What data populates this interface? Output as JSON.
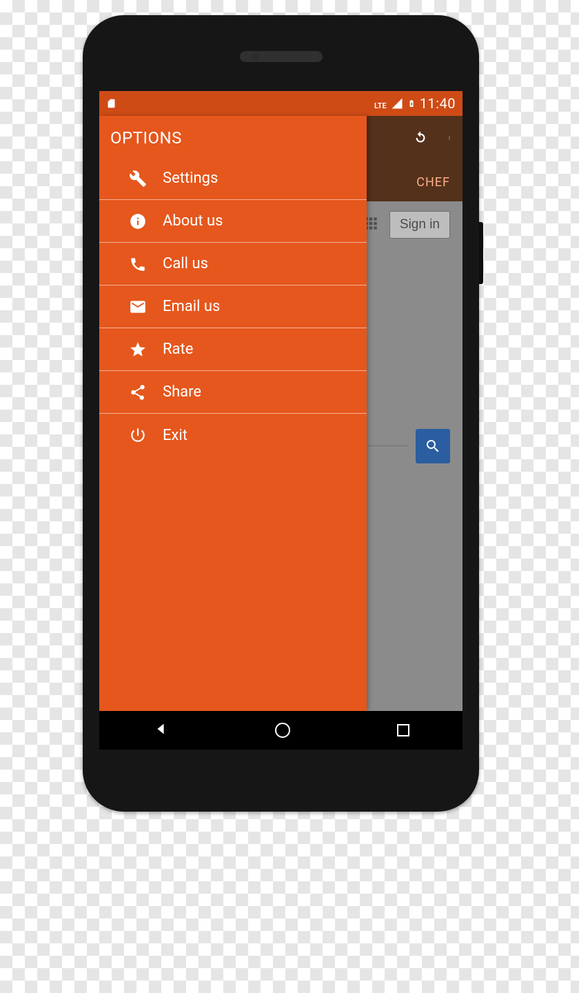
{
  "statusbar": {
    "network_label": "LTE",
    "clock": "11:40"
  },
  "appbar_behind": {
    "tab_label": "CHEF",
    "signin_label": "Sign in"
  },
  "drawer": {
    "title": "OPTIONS",
    "items": [
      {
        "icon": "wrench-icon",
        "label": "Settings"
      },
      {
        "icon": "info-icon",
        "label": "About us"
      },
      {
        "icon": "phone-icon",
        "label": "Call us"
      },
      {
        "icon": "email-icon",
        "label": "Email us"
      },
      {
        "icon": "star-icon",
        "label": "Rate"
      },
      {
        "icon": "share-icon",
        "label": "Share"
      },
      {
        "icon": "power-icon",
        "label": "Exit"
      }
    ]
  },
  "colors": {
    "primary": "#e5571d",
    "primary_dark": "#cf4b16",
    "behind_appbar": "#4e270e",
    "search_button": "#2a5ea0"
  }
}
